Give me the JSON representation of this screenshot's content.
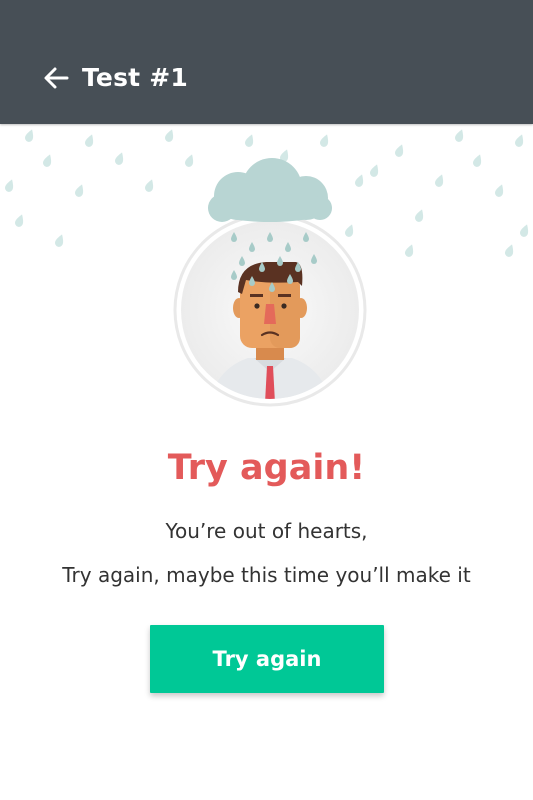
{
  "header": {
    "title": "Test #1",
    "back_icon": "arrow-left-icon",
    "background": "#474f56"
  },
  "illustration": {
    "description_icons": [
      "rain-cloud-icon",
      "sad-man-avatar-icon"
    ]
  },
  "result": {
    "heading": "Try again!",
    "heading_color": "#e35a5a",
    "line1": "You’re out of hearts,",
    "line2": "Try again, maybe this time you’ll make it"
  },
  "cta": {
    "label": "Try again",
    "color": "#00c896"
  }
}
